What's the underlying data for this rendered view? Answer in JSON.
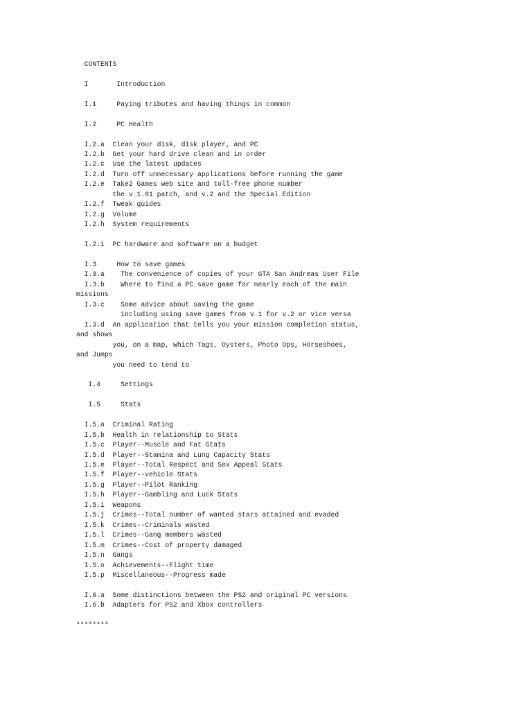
{
  "document": {
    "heading": "CONTENTS",
    "separator": "********",
    "lines": [
      {
        "id": "heading",
        "text": "  CONTENTS",
        "kind": "heading"
      },
      {
        "id": "blank-1",
        "text": "",
        "kind": "blank"
      },
      {
        "id": "sec-I",
        "text": "  I       Introduction",
        "kind": "entry"
      },
      {
        "id": "blank-2",
        "text": "",
        "kind": "blank"
      },
      {
        "id": "sec-I-1",
        "text": "  I.1     Paying tributes and having things in common",
        "kind": "entry"
      },
      {
        "id": "blank-3",
        "text": "",
        "kind": "blank"
      },
      {
        "id": "sec-I-2",
        "text": "  I.2     PC Health",
        "kind": "entry"
      },
      {
        "id": "blank-4",
        "text": "",
        "kind": "blank"
      },
      {
        "id": "sec-I-2-a",
        "text": "  I.2.a  Clean your disk, disk player, and PC",
        "kind": "entry"
      },
      {
        "id": "sec-I-2-b",
        "text": "  I.2.b  Get your hard drive clean and in order",
        "kind": "entry"
      },
      {
        "id": "sec-I-2-c",
        "text": "  I.2.c  Use the latest updates",
        "kind": "entry"
      },
      {
        "id": "sec-I-2-d",
        "text": "  I.2.d  Turn off unnecessary applications before running the game",
        "kind": "entry"
      },
      {
        "id": "sec-I-2-e",
        "text": "  I.2.e  Take2 Games web site and toll-free phone number",
        "kind": "entry"
      },
      {
        "id": "sec-I-2-e-cont",
        "text": "         the v 1.01 patch, and v.2 and the Special Edition",
        "kind": "continuation"
      },
      {
        "id": "sec-I-2-f",
        "text": "  I.2.f  Tweak guides",
        "kind": "entry"
      },
      {
        "id": "sec-I-2-g",
        "text": "  I.2.g  Volume",
        "kind": "entry"
      },
      {
        "id": "sec-I-2-h",
        "text": "  I.2.h  System requirements",
        "kind": "entry"
      },
      {
        "id": "blank-5",
        "text": "",
        "kind": "blank"
      },
      {
        "id": "sec-I-2-i",
        "text": "  I.2.i  PC hardware and software on a budget",
        "kind": "entry"
      },
      {
        "id": "blank-6",
        "text": "",
        "kind": "blank"
      },
      {
        "id": "sec-I-3",
        "text": "  I.3     How to save games",
        "kind": "entry"
      },
      {
        "id": "sec-I-3-a",
        "text": "  I.3.a    The convenience of copies of your GTA San Andreas User File",
        "kind": "entry"
      },
      {
        "id": "sec-I-3-b",
        "text": "  I.3.b    Where to find a PC save game for nearly each of the main",
        "kind": "entry"
      },
      {
        "id": "sec-I-3-b-wrap",
        "text": "missions",
        "kind": "wrap"
      },
      {
        "id": "sec-I-3-c",
        "text": "  I.3.c    Some advice about saving the game",
        "kind": "entry"
      },
      {
        "id": "sec-I-3-c-cont",
        "text": "           including using save games from v.1 for v.2 or vice versa",
        "kind": "continuation"
      },
      {
        "id": "sec-I-3-d",
        "text": "  I.3.d  An application that tells you your mission completion status,",
        "kind": "entry"
      },
      {
        "id": "sec-I-3-d-wrap-1",
        "text": "and shows",
        "kind": "wrap"
      },
      {
        "id": "sec-I-3-d-cont-1",
        "text": "         you, on a map, which Tags, Oysters, Photo Ops, Horseshoes,",
        "kind": "continuation"
      },
      {
        "id": "sec-I-3-d-wrap-2",
        "text": "and Jumps",
        "kind": "wrap"
      },
      {
        "id": "sec-I-3-d-cont-2",
        "text": "         you need to tend to",
        "kind": "continuation"
      },
      {
        "id": "blank-7",
        "text": "",
        "kind": "blank"
      },
      {
        "id": "sec-I-4",
        "text": "   I.4     Settings",
        "kind": "entry"
      },
      {
        "id": "blank-8",
        "text": "",
        "kind": "blank"
      },
      {
        "id": "sec-I-5",
        "text": "   I.5     Stats",
        "kind": "entry"
      },
      {
        "id": "blank-9",
        "text": "",
        "kind": "blank"
      },
      {
        "id": "sec-I-5-a",
        "text": "  I.5.a  Criminal Rating",
        "kind": "entry"
      },
      {
        "id": "sec-I-5-b",
        "text": "  I.5.b  Health in relationship to Stats",
        "kind": "entry"
      },
      {
        "id": "sec-I-5-c",
        "text": "  I.5.c  Player--Muscle and Fat Stats",
        "kind": "entry"
      },
      {
        "id": "sec-I-5-d",
        "text": "  I.5.d  Player--Stamina and Lung Capacity Stats",
        "kind": "entry"
      },
      {
        "id": "sec-I-5-e",
        "text": "  I.5.e  Player--Total Respect and Sex Appeal Stats",
        "kind": "entry"
      },
      {
        "id": "sec-I-5-f",
        "text": "  I.5.f  Player--vehicle Stats",
        "kind": "entry"
      },
      {
        "id": "sec-I-5-g",
        "text": "  I.5.g  Player--Pilot Ranking",
        "kind": "entry"
      },
      {
        "id": "sec-I-5-h",
        "text": "  I.5.h  Player--Gambling and Luck Stats",
        "kind": "entry"
      },
      {
        "id": "sec-I-5-i",
        "text": "  I.5.i  Weapons",
        "kind": "entry"
      },
      {
        "id": "sec-I-5-j",
        "text": "  I.5.j  Crimes--Total number of wanted stars attained and evaded",
        "kind": "entry"
      },
      {
        "id": "sec-I-5-k",
        "text": "  I.5.k  Crimes--Criminals wasted",
        "kind": "entry"
      },
      {
        "id": "sec-I-5-l",
        "text": "  I.5.l  Crimes--Gang members wasted",
        "kind": "entry"
      },
      {
        "id": "sec-I-5-m",
        "text": "  I.5.m  Crimes--Cost of property damaged",
        "kind": "entry"
      },
      {
        "id": "sec-I-5-n",
        "text": "  I.5.n  Gangs",
        "kind": "entry"
      },
      {
        "id": "sec-I-5-o",
        "text": "  I.5.o  Achievements--Flight time",
        "kind": "entry"
      },
      {
        "id": "sec-I-5-p",
        "text": "  I.5.p  Miscellaneous--Progress made",
        "kind": "entry"
      },
      {
        "id": "blank-10",
        "text": "",
        "kind": "blank"
      },
      {
        "id": "sec-I-6-a",
        "text": "  I.6.a  Some distinctions between the PS2 and original PC versions",
        "kind": "entry"
      },
      {
        "id": "sec-I-6-b",
        "text": "  I.6.b  Adapters for PS2 and Xbox controllers",
        "kind": "entry"
      },
      {
        "id": "blank-11",
        "text": "",
        "kind": "blank"
      },
      {
        "id": "separator",
        "text": "********",
        "kind": "separator"
      }
    ]
  }
}
